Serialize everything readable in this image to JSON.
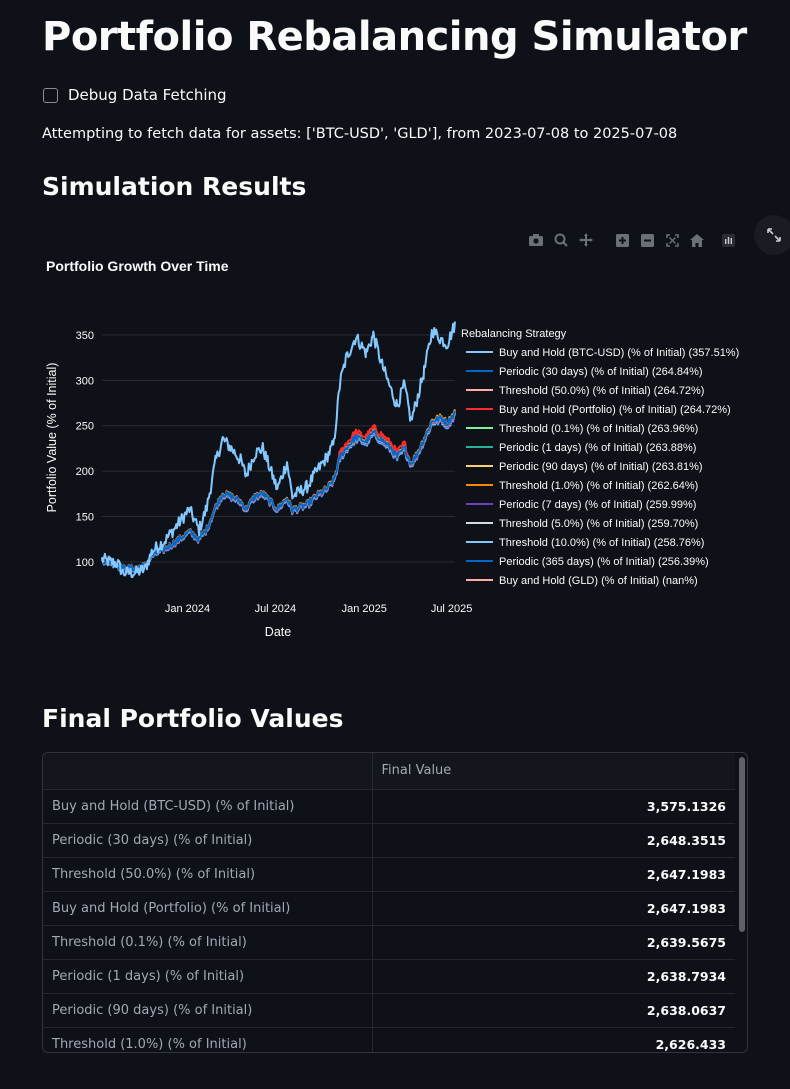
{
  "page": {
    "title": "Portfolio Rebalancing Simulator",
    "debug_label": "Debug Data Fetching",
    "fetch_message": "Attempting to fetch data for assets: ['BTC-USD', 'GLD'], from 2023-07-08 to 2025-07-08",
    "results_heading": "Simulation Results",
    "final_heading": "Final Portfolio Values"
  },
  "toolbar": {
    "icons": [
      "camera-icon",
      "zoom-icon",
      "pan-icon",
      "zoom-in-icon",
      "zoom-out-icon",
      "autoscale-icon",
      "reset-axes-icon",
      "plotly-logo-icon"
    ],
    "expand_icon": "expand-icon"
  },
  "chart_data": {
    "type": "line",
    "title": "Portfolio Growth Over Time",
    "xlabel": "Date",
    "ylabel": "Portfolio Value (% of Initial)",
    "x_ticks": [
      "Jan 2024",
      "Jul 2024",
      "Jan 2025",
      "Jul 2025"
    ],
    "x_tick_dates": [
      "2024-01-01",
      "2024-07-01",
      "2025-01-01",
      "2025-07-01"
    ],
    "x_range": [
      "2023-07-08",
      "2025-07-08"
    ],
    "y_ticks": [
      100,
      150,
      200,
      250,
      300,
      350
    ],
    "ylim": [
      80,
      372
    ],
    "grid": true,
    "legend_title": "Rebalancing Strategy",
    "legend_position": "right",
    "series": [
      {
        "name": "Buy and Hold (BTC-USD) (% of Initial) (357.51%)",
        "color": "#83c9ff",
        "kind": "btc"
      },
      {
        "name": "Periodic (30 days) (% of Initial) (264.84%)",
        "color": "#0068c9",
        "kind": "port",
        "offset": 0.5
      },
      {
        "name": "Threshold (50.0%) (% of Initial) (264.72%)",
        "color": "#ffabab",
        "kind": "port",
        "offset": 0.0
      },
      {
        "name": "Buy and Hold (Portfolio) (% of Initial) (264.72%)",
        "color": "#ff2b2b",
        "kind": "bh"
      },
      {
        "name": "Threshold (0.1%) (% of Initial) (263.96%)",
        "color": "#7defa1",
        "kind": "port",
        "offset": -0.3
      },
      {
        "name": "Periodic (1 days) (% of Initial) (263.88%)",
        "color": "#29b09d",
        "kind": "port",
        "offset": -0.4
      },
      {
        "name": "Periodic (90 days) (% of Initial) (263.81%)",
        "color": "#ffd16a",
        "kind": "port",
        "offset": 1.0
      },
      {
        "name": "Threshold (1.0%) (% of Initial) (262.64%)",
        "color": "#ff8700",
        "kind": "port",
        "offset": 2.0
      },
      {
        "name": "Periodic (7 days) (% of Initial) (259.99%)",
        "color": "#6d3fc0",
        "kind": "port",
        "offset": -1.5
      },
      {
        "name": "Threshold (5.0%) (% of Initial) (259.70%)",
        "color": "#d5dae5",
        "kind": "port",
        "offset": -2.0
      },
      {
        "name": "Threshold (10.0%) (% of Initial) (258.76%)",
        "color": "#83c9ff",
        "kind": "port",
        "offset": -2.5
      },
      {
        "name": "Periodic (365 days) (% of Initial) (256.39%)",
        "color": "#0068c9",
        "kind": "port",
        "offset": -3.5
      },
      {
        "name": "Buy and Hold (GLD) (% of Initial) (nan%)",
        "color": "#ffabab",
        "kind": "none"
      }
    ],
    "anchors": {
      "btc": [
        [
          "2023-07-08",
          103
        ],
        [
          "2023-07-25",
          100
        ],
        [
          "2023-08-10",
          98
        ],
        [
          "2023-08-20",
          88
        ],
        [
          "2023-09-15",
          88
        ],
        [
          "2023-10-05",
          92
        ],
        [
          "2023-10-20",
          112
        ],
        [
          "2023-11-15",
          123
        ],
        [
          "2023-12-10",
          140
        ],
        [
          "2024-01-05",
          158
        ],
        [
          "2024-01-25",
          135
        ],
        [
          "2024-02-10",
          160
        ],
        [
          "2024-02-28",
          210
        ],
        [
          "2024-03-14",
          235
        ],
        [
          "2024-04-01",
          225
        ],
        [
          "2024-04-20",
          212
        ],
        [
          "2024-05-01",
          195
        ],
        [
          "2024-05-20",
          220
        ],
        [
          "2024-06-05",
          225
        ],
        [
          "2024-07-05",
          180
        ],
        [
          "2024-07-25",
          210
        ],
        [
          "2024-08-05",
          172
        ],
        [
          "2024-09-05",
          183
        ],
        [
          "2024-09-25",
          200
        ],
        [
          "2024-10-15",
          215
        ],
        [
          "2024-10-30",
          230
        ],
        [
          "2024-11-12",
          298
        ],
        [
          "2024-11-25",
          325
        ],
        [
          "2024-12-15",
          348
        ],
        [
          "2025-01-05",
          330
        ],
        [
          "2025-01-20",
          350
        ],
        [
          "2025-02-05",
          320
        ],
        [
          "2025-02-25",
          290
        ],
        [
          "2025-03-10",
          272
        ],
        [
          "2025-03-25",
          295
        ],
        [
          "2025-04-08",
          255
        ],
        [
          "2025-04-20",
          278
        ],
        [
          "2025-05-05",
          310
        ],
        [
          "2025-05-22",
          355
        ],
        [
          "2025-06-10",
          345
        ],
        [
          "2025-06-22",
          340
        ],
        [
          "2025-07-08",
          362
        ]
      ],
      "port": [
        [
          "2023-07-08",
          102
        ],
        [
          "2023-07-25",
          100
        ],
        [
          "2023-08-20",
          93
        ],
        [
          "2023-09-15",
          93
        ],
        [
          "2023-10-05",
          96
        ],
        [
          "2023-10-20",
          107
        ],
        [
          "2023-11-15",
          114
        ],
        [
          "2023-12-10",
          123
        ],
        [
          "2024-01-05",
          133
        ],
        [
          "2024-01-25",
          125
        ],
        [
          "2024-02-10",
          136
        ],
        [
          "2024-02-28",
          160
        ],
        [
          "2024-03-14",
          175
        ],
        [
          "2024-04-01",
          172
        ],
        [
          "2024-04-20",
          166
        ],
        [
          "2024-05-01",
          158
        ],
        [
          "2024-05-20",
          172
        ],
        [
          "2024-06-05",
          175
        ],
        [
          "2024-07-05",
          158
        ],
        [
          "2024-07-25",
          170
        ],
        [
          "2024-08-05",
          157
        ],
        [
          "2024-09-05",
          163
        ],
        [
          "2024-09-25",
          173
        ],
        [
          "2024-10-15",
          180
        ],
        [
          "2024-10-30",
          190
        ],
        [
          "2024-11-12",
          215
        ],
        [
          "2024-11-25",
          225
        ],
        [
          "2024-12-15",
          237
        ],
        [
          "2025-01-05",
          232
        ],
        [
          "2025-01-20",
          242
        ],
        [
          "2025-02-05",
          235
        ],
        [
          "2025-02-25",
          225
        ],
        [
          "2025-03-10",
          215
        ],
        [
          "2025-03-25",
          225
        ],
        [
          "2025-04-08",
          208
        ],
        [
          "2025-04-20",
          218
        ],
        [
          "2025-05-05",
          235
        ],
        [
          "2025-05-22",
          255
        ],
        [
          "2025-06-10",
          258
        ],
        [
          "2025-06-22",
          252
        ],
        [
          "2025-07-08",
          264
        ]
      ]
    }
  },
  "table": {
    "column_header": "Final Value",
    "rows": [
      {
        "label": "Buy and Hold (BTC-USD) (% of Initial)",
        "value": "3,575.1326"
      },
      {
        "label": "Periodic (30 days) (% of Initial)",
        "value": "2,648.3515"
      },
      {
        "label": "Threshold (50.0%) (% of Initial)",
        "value": "2,647.1983"
      },
      {
        "label": "Buy and Hold (Portfolio) (% of Initial)",
        "value": "2,647.1983"
      },
      {
        "label": "Threshold (0.1%) (% of Initial)",
        "value": "2,639.5675"
      },
      {
        "label": "Periodic (1 days) (% of Initial)",
        "value": "2,638.7934"
      },
      {
        "label": "Periodic (90 days) (% of Initial)",
        "value": "2,638.0637"
      },
      {
        "label": "Threshold (1.0%) (% of Initial)",
        "value": "2,626.433"
      }
    ]
  }
}
